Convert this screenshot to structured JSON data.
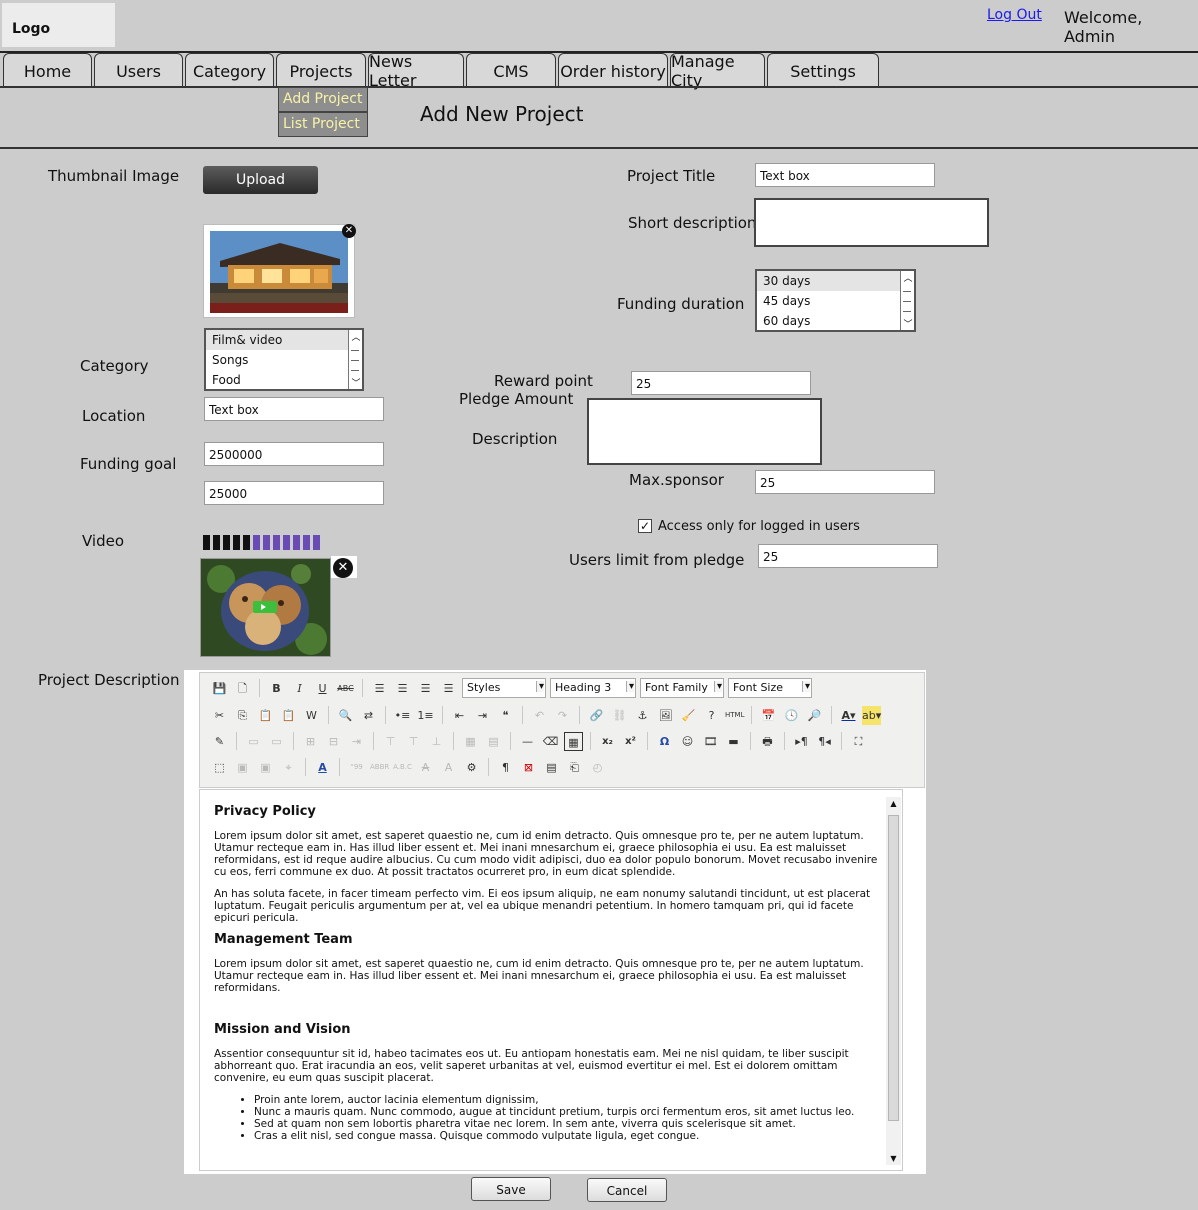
{
  "header": {
    "logo": "Logo",
    "logout": "Log Out",
    "welcome": "Welcome, Admin"
  },
  "nav": {
    "tabs": [
      "Home",
      "Users",
      "Category",
      "Projects",
      "News Letter",
      "CMS",
      "Order history",
      "Manage City",
      "Settings"
    ],
    "projects_submenu": [
      "Add Project",
      "List Project"
    ]
  },
  "page_title": "Add New Project",
  "form": {
    "thumbnail_label": "Thumbnail Image",
    "upload_button": "Upload",
    "category_label": "Category",
    "category_options": [
      "Film& video",
      "Songs",
      "Food"
    ],
    "location_label": "Location",
    "location_value": "Text box",
    "funding_goal_label": "Funding goal",
    "funding_goal_value": "2500000",
    "funding_goal_value2": "25000",
    "video_label": "Video",
    "project_title_label": "Project Title",
    "project_title_value": "Text box",
    "short_description_label": "Short description",
    "funding_duration_label": "Funding duration",
    "funding_duration_options": [
      "30 days",
      "45 days",
      "60 days"
    ],
    "reward_point_label": "Reward point",
    "pledge_amount_label": "Pledge Amount",
    "reward_point_value": "25",
    "description_label": "Description",
    "max_sponsor_label": "Max.sponsor",
    "max_sponsor_value": "25",
    "access_checkbox_label": "Access only for logged in users",
    "access_checked": true,
    "users_limit_label": "Users limit from pledge",
    "users_limit_value": "25",
    "project_description_label": "Project Description"
  },
  "editor": {
    "dropdowns": {
      "styles": "Styles",
      "heading": "Heading 3",
      "font_family": "Font Family",
      "font_size": "Font Size"
    },
    "content": {
      "h1": "Privacy Policy",
      "p1": "Lorem ipsum dolor sit amet, est saperet quaestio ne, cum id enim detracto. Quis omnesque pro te, per ne autem luptatum. Utamur recteque eam in. Has illud liber essent et. Mei inani mnesarchum ei, graece philosophia ei usu. Ea est maluisset reformidans, est id reque audire albucius. Cu cum modo vidit adipisci, duo ea dolor populo bonorum. Movet recusabo invenire cu eos, ferri commune ex duo. At possit tractatos ocurreret pro, in eum dicat splendide.",
      "p2": "An has soluta facete, in facer timeam perfecto vim. Ei eos ipsum aliquip, ne eam nonumy salutandi tincidunt, ut est placerat luptatum. Feugait periculis argumentum per at, vel ea ubique menandri petentium. In homero tamquam pri, qui id facete epicuri pericula.",
      "h2": "Management Team",
      "p3": "Lorem ipsum dolor sit amet, est saperet quaestio ne, cum id enim detracto. Quis omnesque pro te, per ne autem luptatum. Utamur recteque eam in. Has illud liber essent et. Mei inani mnesarchum ei, graece philosophia ei usu. Ea est maluisset reformidans.",
      "h3": "Mission and Vision",
      "p4": "Assentior consequuntur sit id, habeo tacimates eos ut. Eu antiopam honestatis eam. Mei ne nisl quidam, te liber suscipit abhorreant quo. Erat iracundia an eos, velit saperet urbanitas at vel, euismod evertitur ei mel. Est ei dolorem omittam convenire, eu eum quas suscipit placerat.",
      "bullets": [
        "Proin ante lorem, auctor lacinia elementum dignissim,",
        "Nunc a mauris quam. Nunc commodo, augue at tincidunt pretium, turpis orci fermentum eros, sit amet luctus leo.",
        "Sed at quam non sem lobortis pharetra vitae nec lorem. In sem ante, viverra quis scelerisque sit amet.",
        "Cras a elit nisl, sed congue massa. Quisque commodo vulputate ligula, eget congue."
      ]
    }
  },
  "actions": {
    "save": "Save",
    "cancel": "Cancel"
  }
}
